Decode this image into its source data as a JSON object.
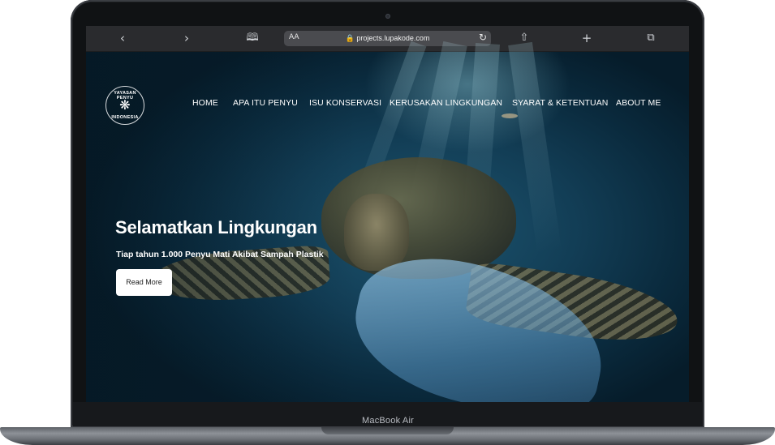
{
  "browser": {
    "back_icon": "chevron-left-icon",
    "forward_icon": "chevron-right-icon",
    "bookmarks_icon": "book-icon",
    "text_size_label": "AA",
    "url": "projects.lupakode.com",
    "reload_icon": "reload-icon",
    "share_icon": "share-icon",
    "new_tab_icon": "plus-icon",
    "tabs_icon": "tabs-icon"
  },
  "site": {
    "logo": {
      "top_text": "YAYASAN PENYU",
      "bottom_text": "INDONESIA",
      "icon": "turtle-icon"
    },
    "nav": [
      {
        "label": "HOME"
      },
      {
        "label": "APA ITU PENYU"
      },
      {
        "label": "ISU KONSERVASI"
      },
      {
        "label": "KERUSAKAN LINGKUNGAN"
      },
      {
        "label": "SYARAT & KETENTUAN"
      },
      {
        "label": "ABOUT ME"
      }
    ],
    "hero": {
      "title": "Selamatkan Lingkungan",
      "subtitle": "Tiap tahun 1.000 Penyu Mati Akibat Sampah Plastik",
      "button_label": "Read More"
    }
  },
  "device": {
    "model_label": "MacBook Air"
  }
}
